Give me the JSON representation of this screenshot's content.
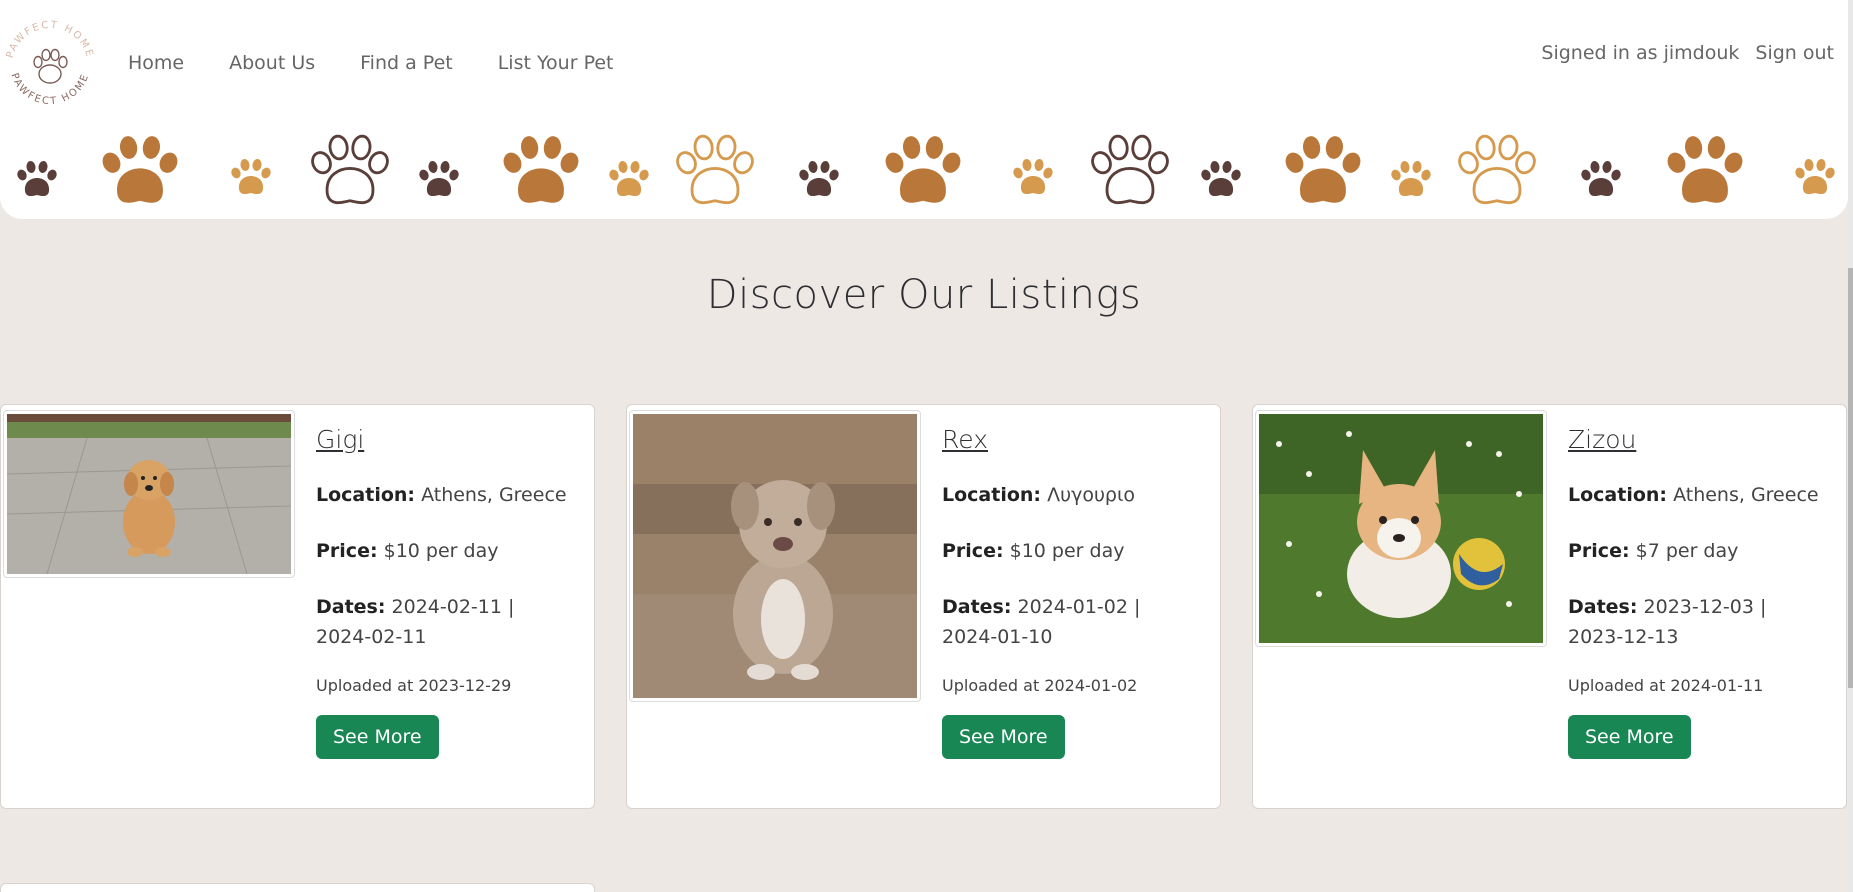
{
  "brand": {
    "logo_text": "PAWFECT HOME"
  },
  "nav": {
    "home": "Home",
    "about": "About Us",
    "find": "Find a Pet",
    "list": "List Your Pet"
  },
  "user": {
    "signed_in": "Signed in as jimdouk",
    "sign_out": "Sign out"
  },
  "colors": {
    "paw_dark": "#5a3e3a",
    "paw_brown": "#b9773a",
    "paw_light": "#d69a4e",
    "button": "#198754",
    "background": "#ede8e3"
  },
  "page": {
    "title": "Discover Our Listings"
  },
  "listings": [
    {
      "name": "Gigi",
      "location_label": "Location:",
      "location": "Athens, Greece",
      "price_label": "Price:",
      "price": "$10 per day",
      "dates_label": "Dates:",
      "dates": "2024-02-11 | 2024-02-11",
      "uploaded": "Uploaded at 2023-12-29",
      "button": "See More"
    },
    {
      "name": "Rex",
      "location_label": "Location:",
      "location": "Λυγουριο",
      "price_label": "Price:",
      "price": "$10 per day",
      "dates_label": "Dates:",
      "dates": "2024-01-02 | 2024-01-10",
      "uploaded": "Uploaded at 2024-01-02",
      "button": "See More"
    },
    {
      "name": "Zizou",
      "location_label": "Location:",
      "location": "Athens, Greece",
      "price_label": "Price:",
      "price": "$7 per day",
      "dates_label": "Dates:",
      "dates": "2023-12-03 | 2023-12-13",
      "uploaded": "Uploaded at 2024-01-11",
      "button": "See More"
    }
  ]
}
